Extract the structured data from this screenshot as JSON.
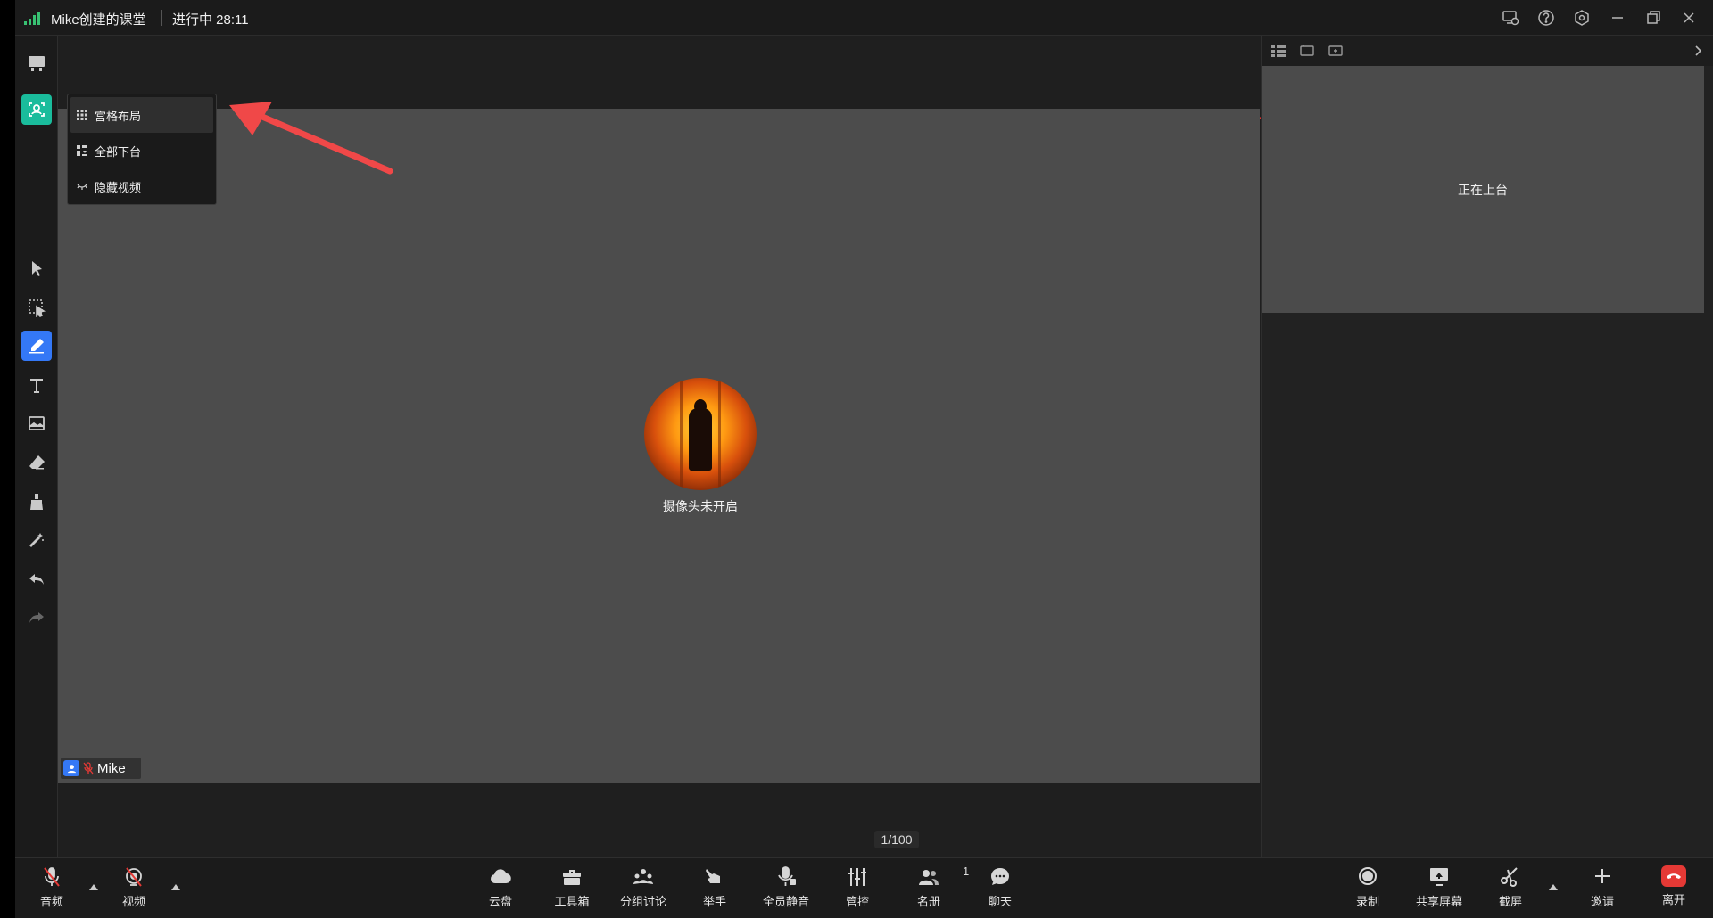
{
  "titlebar": {
    "room_title": "Mike创建的课堂",
    "status": "进行中 28:11"
  },
  "menu": {
    "items": [
      {
        "label": "宫格布局",
        "icon": "grid-icon",
        "selected": true
      },
      {
        "label": "全部下台",
        "icon": "stage-down-icon",
        "selected": false
      },
      {
        "label": "隐藏视频",
        "icon": "hide-video-icon",
        "selected": false
      }
    ]
  },
  "stage": {
    "camera_off_text": "摄像头未开启",
    "participant_name": "Mike",
    "page_indicator": "1/100"
  },
  "right_panel": {
    "on_stage_label": "正在上台"
  },
  "bottom_bar": {
    "left": [
      {
        "label": "音频",
        "icon": "mic-muted-icon"
      },
      {
        "label": "视频",
        "icon": "video-off-icon"
      }
    ],
    "center": [
      {
        "label": "云盘",
        "icon": "cloud-icon"
      },
      {
        "label": "工具箱",
        "icon": "toolbox-icon"
      },
      {
        "label": "分组讨论",
        "icon": "group-icon"
      },
      {
        "label": "举手",
        "icon": "raise-hand-icon"
      },
      {
        "label": "全员静音",
        "icon": "mute-all-icon"
      },
      {
        "label": "管控",
        "icon": "control-icon"
      },
      {
        "label": "名册",
        "icon": "roster-icon",
        "count": "1"
      },
      {
        "label": "聊天",
        "icon": "chat-icon"
      }
    ],
    "right": [
      {
        "label": "录制",
        "icon": "record-icon"
      },
      {
        "label": "共享屏幕",
        "icon": "share-screen-icon"
      },
      {
        "label": "截屏",
        "icon": "screenshot-icon"
      },
      {
        "label": "邀请",
        "icon": "invite-icon"
      },
      {
        "label": "离开",
        "icon": "leave-icon"
      }
    ]
  },
  "colors": {
    "accent_blue": "#3478f6",
    "accent_green": "#1abc9c",
    "leave_red": "#e53935",
    "arrow_red": "#f04848"
  }
}
